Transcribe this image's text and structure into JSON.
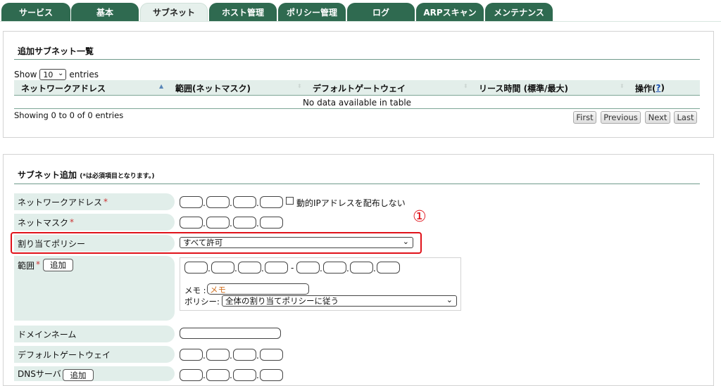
{
  "tabs": [
    {
      "label": "サービス",
      "active": false
    },
    {
      "label": "基本",
      "active": false
    },
    {
      "label": "サブネット",
      "active": true
    },
    {
      "label": "ホスト管理",
      "active": false
    },
    {
      "label": "ポリシー管理",
      "active": false
    },
    {
      "label": "ログ",
      "active": false
    },
    {
      "label": "ARPスキャン",
      "active": false
    },
    {
      "label": "メンテナンス",
      "active": false
    }
  ],
  "subnet_list": {
    "title": "追加サブネット一覧",
    "show_prefix": "Show",
    "page_length": "10",
    "show_suffix": "entries",
    "columns": [
      "ネットワークアドレス",
      "範囲(ネットマスク)",
      "デフォルトゲートウェイ",
      "リース時間 (標準/最大)",
      "操作("
    ],
    "help_mark": "?",
    "close_paren": ")",
    "empty_message": "No data available in table",
    "info": "Showing 0 to 0 of 0 entries",
    "pager": [
      "First",
      "Previous",
      "Next",
      "Last"
    ]
  },
  "subnet_add": {
    "title": "サブネット追加",
    "note": "(*は必須項目となります。)",
    "required_mark": "*",
    "network_address_label": "ネットワークアドレス",
    "no_dynamic_label": "動的IPアドレスを配布しない",
    "netmask_label": "ネットマスク",
    "policy_label": "割り当てポリシー",
    "policy_value": "すべて許可",
    "range_label": "範囲",
    "add_button": "追加",
    "range_dash": "-",
    "memo_label": "メモ :",
    "memo_placeholder": "メモ",
    "range_policy_label": "ポリシー:",
    "range_policy_value": "全体の割り当てポリシーに従う",
    "domain_label": "ドメインネーム",
    "gateway_label": "デフォルトゲートウェイ",
    "dns_label": "DNSサーバ",
    "dot": "."
  },
  "annotation": {
    "marker": "①"
  },
  "colors": {
    "tab": "#2f6a50",
    "label_bg": "#e1eeea",
    "highlight": "#e0121a"
  }
}
